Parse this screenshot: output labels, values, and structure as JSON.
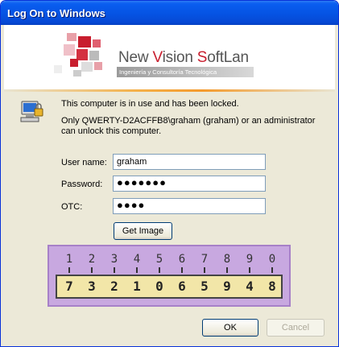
{
  "window": {
    "title": "Log On to Windows"
  },
  "banner": {
    "brand_prefix_1": "New ",
    "brand_v": "V",
    "brand_mid": "ision ",
    "brand_s": "S",
    "brand_suffix": "oftLan",
    "brand_subtitle": "Ingeniería y Consultoría Tecnológica"
  },
  "messages": {
    "locked": "This computer is in use and has been locked.",
    "unlock_info": "Only QWERTY-D2ACFFB8\\graham (graham) or an administrator can unlock this computer."
  },
  "form": {
    "username_label": "User name:",
    "username_value": "graham",
    "password_label": "Password:",
    "password_value": "●●●●●●●",
    "otc_label": "OTC:",
    "otc_value": "●●●●"
  },
  "buttons": {
    "get_image": "Get Image",
    "ok": "OK",
    "cancel": "Cancel"
  },
  "otc_card": {
    "top_digits": [
      "1",
      "2",
      "3",
      "4",
      "5",
      "6",
      "7",
      "8",
      "9",
      "0"
    ],
    "bottom_digits": [
      "7",
      "3",
      "2",
      "1",
      "0",
      "6",
      "5",
      "9",
      "4",
      "8"
    ]
  },
  "colors": {
    "title_bar": "#0553e3",
    "brand_red": "#c81e2e",
    "otc_panel": "#c8a8e0",
    "otc_strip": "#f2e6a8"
  }
}
